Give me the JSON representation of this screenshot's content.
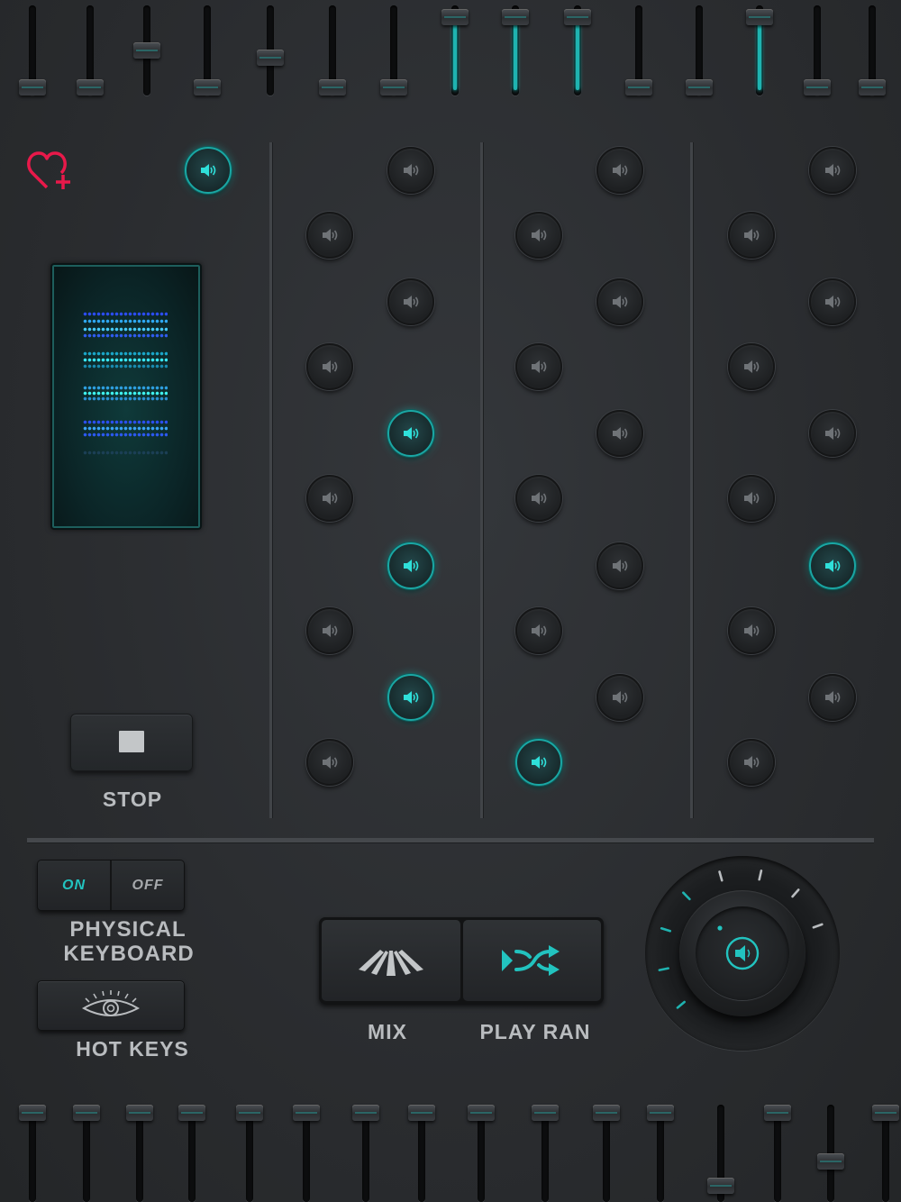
{
  "pad_icon": "speaker-icon",
  "accent_color": "#1fb3b0",
  "favorite": {
    "icon": "heart-plus-icon",
    "color": "#e8194a"
  },
  "top_faders": [
    {
      "level": 0.0
    },
    {
      "level": 0.0
    },
    {
      "level": 0.5
    },
    {
      "level": 0.0
    },
    {
      "level": 0.4
    },
    {
      "level": 0.0
    },
    {
      "level": 0.0
    },
    {
      "level": 0.95
    },
    {
      "level": 0.95
    },
    {
      "level": 0.95
    },
    {
      "level": 0.0
    },
    {
      "level": 0.0
    },
    {
      "level": 0.95
    },
    {
      "level": 0.0
    },
    {
      "level": 0.0
    }
  ],
  "bottom_faders": [
    {
      "level": 1.0
    },
    {
      "level": 1.0
    },
    {
      "level": 1.0
    },
    {
      "level": 1.0
    },
    {
      "level": 1.0
    },
    {
      "level": 1.0
    },
    {
      "level": 1.0
    },
    {
      "level": 1.0
    },
    {
      "level": 1.0
    },
    {
      "level": 1.0
    },
    {
      "level": 1.0
    },
    {
      "level": 1.0
    },
    {
      "level": 0.1
    },
    {
      "level": 1.0
    },
    {
      "level": 0.4
    },
    {
      "level": 1.0
    }
  ],
  "pad_columns": [
    {
      "pads": [
        {
          "active": true
        }
      ]
    },
    {
      "pads": [
        {
          "active": false
        },
        {
          "active": false
        },
        {
          "active": false
        },
        {
          "active": false
        },
        {
          "active": true
        },
        {
          "active": false
        },
        {
          "active": true
        },
        {
          "active": false
        },
        {
          "active": true
        },
        {
          "active": false
        }
      ]
    },
    {
      "pads": [
        {
          "active": false
        },
        {
          "active": false
        },
        {
          "active": false
        },
        {
          "active": false
        },
        {
          "active": false
        },
        {
          "active": false
        },
        {
          "active": false
        },
        {
          "active": false
        },
        {
          "active": false
        },
        {
          "active": true
        }
      ]
    },
    {
      "pads": [
        {
          "active": false
        },
        {
          "active": false
        },
        {
          "active": false
        },
        {
          "active": false
        },
        {
          "active": false
        },
        {
          "active": false
        },
        {
          "active": true
        },
        {
          "active": false
        },
        {
          "active": false
        },
        {
          "active": false
        }
      ]
    }
  ],
  "stop": {
    "label": "STOP"
  },
  "keyboard": {
    "on_label": "ON",
    "off_label": "OFF",
    "label_line1": "PHYSICAL",
    "label_line2": "KEYBOARD",
    "state": "on"
  },
  "hot_keys": {
    "label": "HOT KEYS",
    "icon": "eye-icon"
  },
  "mix": {
    "label": "MIX",
    "icon": "mix-icon"
  },
  "play_random": {
    "label": "PLAY RAN",
    "icon": "shuffle-icon"
  },
  "volume_knob": {
    "icon": "speaker-icon",
    "level": 0.55
  }
}
